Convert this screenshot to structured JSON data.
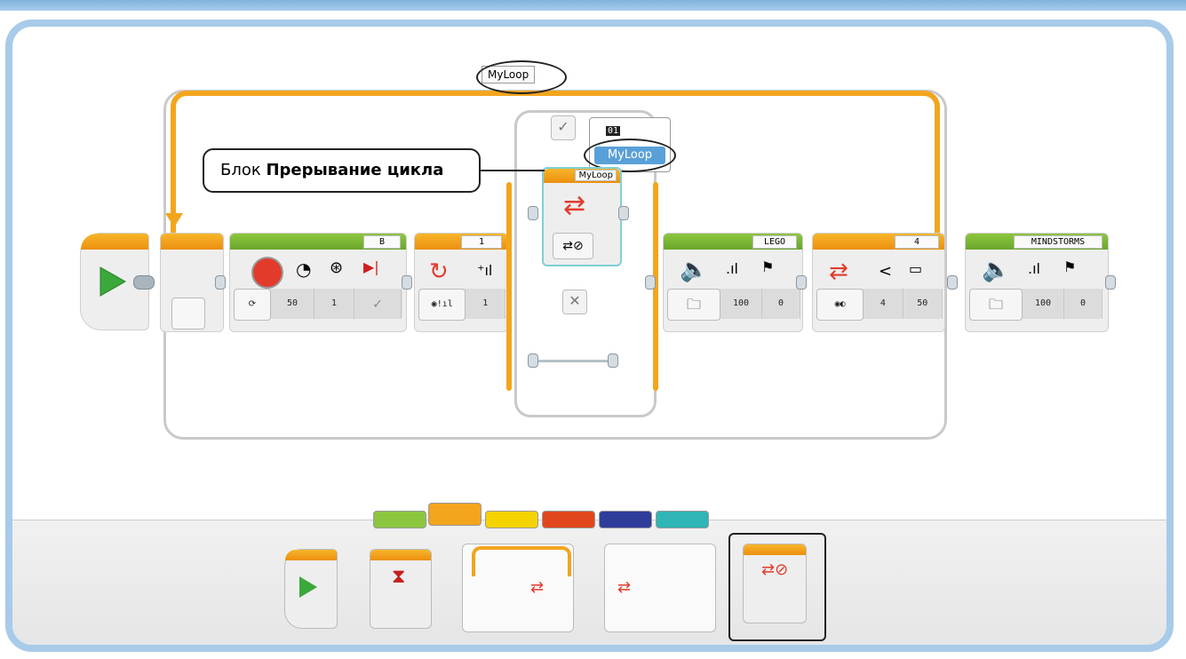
{
  "loop": {
    "name": "MyLoop"
  },
  "callout": {
    "text_plain": "Блок ",
    "text_bold": "Прерывание цикла"
  },
  "switch": {
    "case_number": "01",
    "case_selected": "MyLoop",
    "interrupt_block_label": "MyLoop",
    "true_icon": "check-icon",
    "false_icon": "cross-icon"
  },
  "blocks": {
    "motor": {
      "port": "B",
      "params": [
        "50",
        "1"
      ],
      "icon": "medium-motor-icon"
    },
    "rotation_sensor": {
      "port": "1",
      "params": [
        "1"
      ],
      "icon": "loop-interrupt-rotation-icon"
    },
    "sound1": {
      "port": "LEGO",
      "params": [
        "100",
        "0"
      ],
      "icon": "speaker-icon"
    },
    "compare": {
      "port": "4",
      "params": [
        "4",
        "50"
      ],
      "icon": "color-sensor-compare-icon"
    },
    "sound2": {
      "port": "MINDSTORMS",
      "params": [
        "100",
        "0"
      ],
      "icon": "speaker-icon"
    }
  },
  "palette": {
    "tabs": [
      {
        "name": "action",
        "color": "#8cc63f"
      },
      {
        "name": "flow",
        "color": "#f3a51d"
      },
      {
        "name": "sensor",
        "color": "#f5d300"
      },
      {
        "name": "data",
        "color": "#e2461d"
      },
      {
        "name": "advanced",
        "color": "#2e3d9a"
      },
      {
        "name": "my-blocks",
        "color": "#2fb5b5"
      }
    ],
    "items": [
      "start-block",
      "wait-block",
      "loop-block",
      "switch-block",
      "loop-interrupt-block"
    ]
  },
  "colors": {
    "accent_orange": "#f3a51d",
    "frame_blue": "#a8cbe9",
    "action_green": "#8cc63f",
    "highlight_blue": "#5aa0d8"
  }
}
